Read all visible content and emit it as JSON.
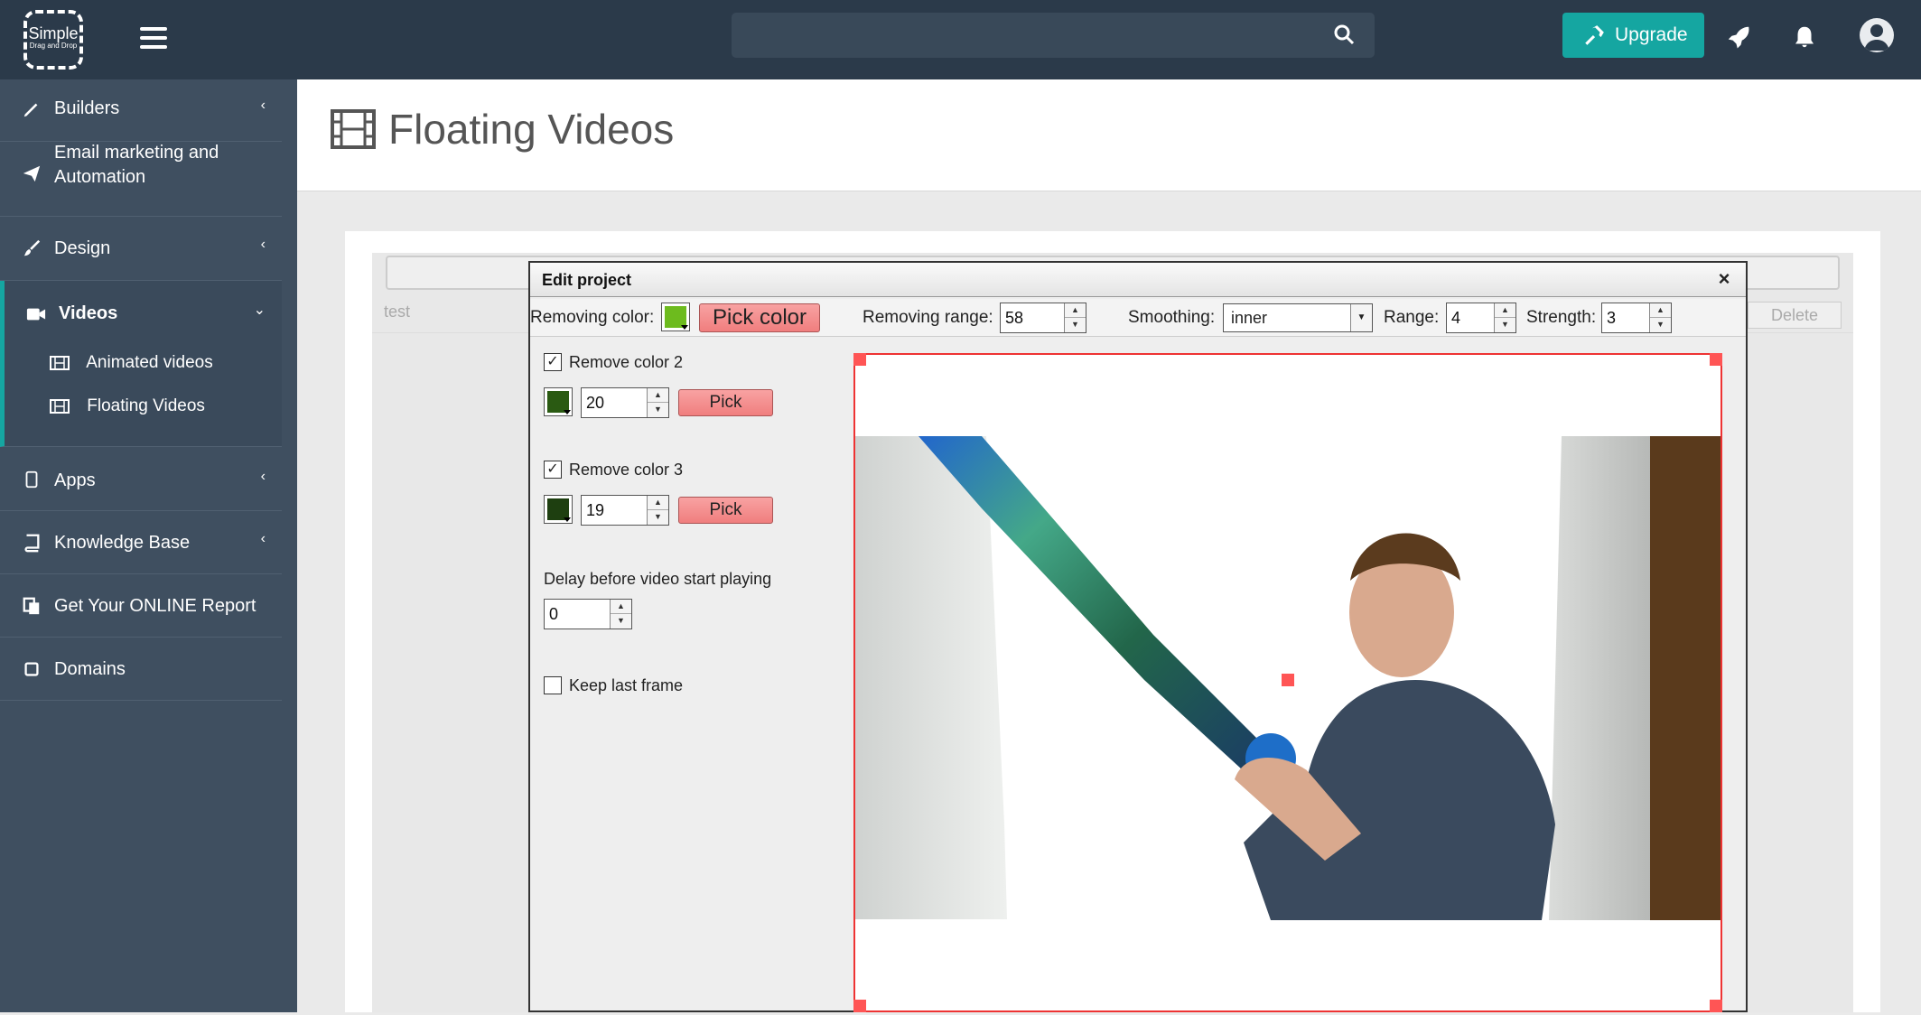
{
  "topbar": {
    "logo_text": "Simple",
    "logo_sub": "Drag and Drop",
    "search_placeholder": "",
    "upgrade_label": "Upgrade"
  },
  "sidebar": {
    "items": [
      {
        "label": "Builders",
        "icon": "pencil-icon"
      },
      {
        "label": "Email marketing and\nAutomation",
        "icon": "paper-plane-icon"
      },
      {
        "label": "Design",
        "icon": "brush-icon"
      },
      {
        "label": "Videos",
        "icon": "video-camera-icon"
      },
      {
        "label": "Apps",
        "icon": "tablet-icon"
      },
      {
        "label": "Knowledge Base",
        "icon": "book-icon"
      },
      {
        "label": "Get Your ONLINE Report",
        "icon": "copy-icon"
      },
      {
        "label": "Domains",
        "icon": "square-icon"
      }
    ],
    "videos_sub": [
      "Animated videos",
      "Floating Videos"
    ]
  },
  "page": {
    "title": "Floating Videos",
    "row_label": "test",
    "delete_label": "Delete"
  },
  "dialog": {
    "title": "Edit project",
    "close": "×",
    "removing_color_label": "Removing color:",
    "pick_color_label": "Pick color",
    "removing_range_label": "Removing range:",
    "removing_range_value": "58",
    "smoothing_label": "Smoothing:",
    "smoothing_value": "inner",
    "range_label": "Range:",
    "range_value": "4",
    "strength_label": "Strength:",
    "strength_value": "3",
    "remove_color2_label": "Remove color 2",
    "remove_color2_value": "20",
    "remove_color3_label": "Remove color 3",
    "remove_color3_value": "19",
    "pick_label": "Pick",
    "delay_label": "Delay before video start playing",
    "delay_value": "0",
    "keep_last_frame_label": "Keep last frame"
  },
  "colors": {
    "topbar": "#2b3a4a",
    "sidebar": "#3f4f60",
    "accent": "#15a6a1",
    "color1": "#6dbb1e",
    "color2": "#2a5a12",
    "color3": "#1e3f10"
  }
}
